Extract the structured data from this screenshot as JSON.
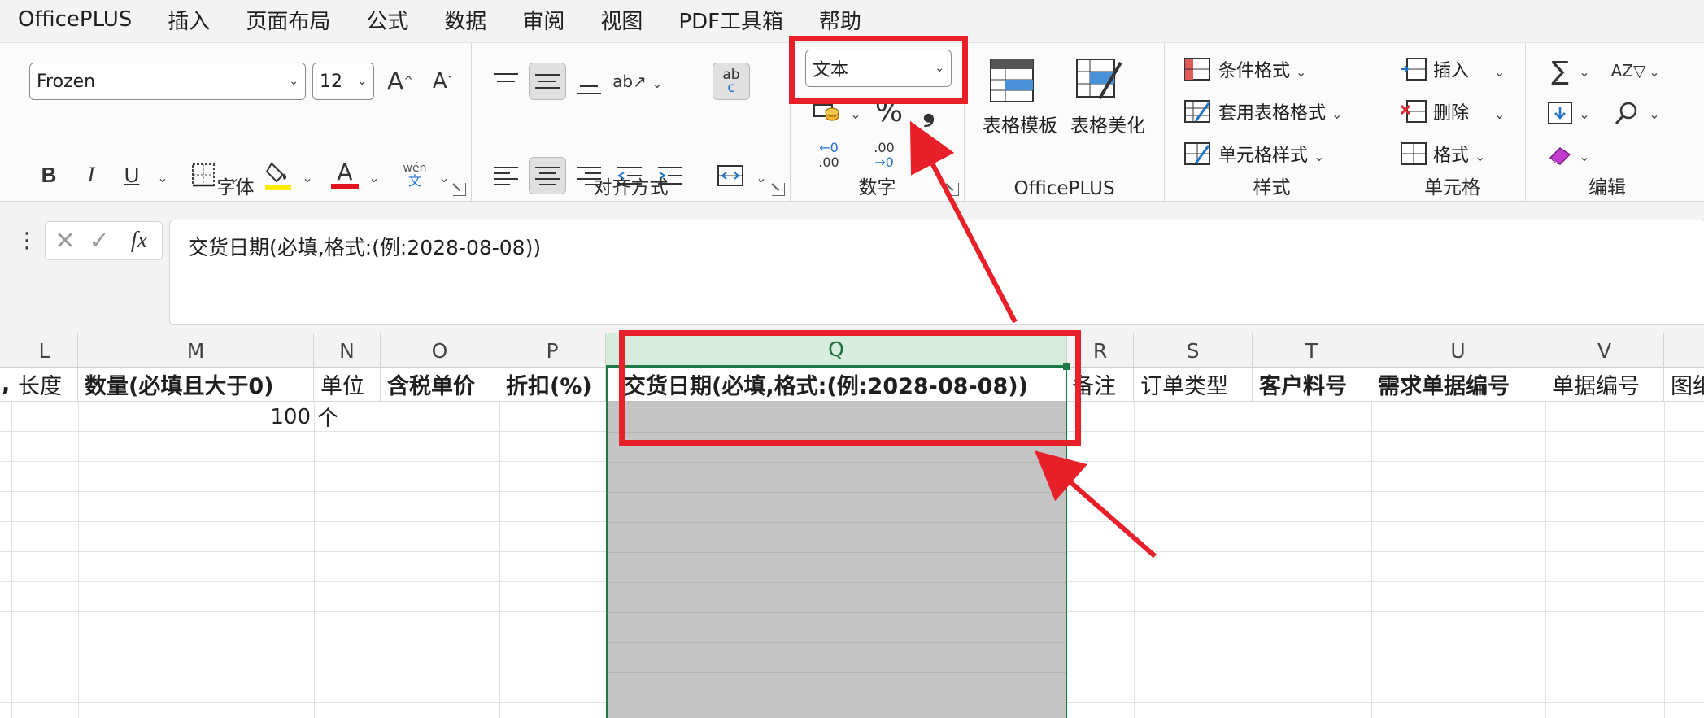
{
  "menu": [
    "OfficePLUS",
    "插入",
    "页面布局",
    "公式",
    "数据",
    "审阅",
    "视图",
    "PDF工具箱",
    "帮助"
  ],
  "font": {
    "name": "Frozen",
    "size": "12",
    "increase_label": "A",
    "decrease_label": "A",
    "bold": "B",
    "italic": "I",
    "underline": "U",
    "font_color_letter": "A",
    "pinyin_top": "wén",
    "pinyin_bottom": "文",
    "group_label": "字体"
  },
  "alignment": {
    "wrap_label": "ab",
    "wrap_label2": "c",
    "group_label": "对齐方式"
  },
  "number": {
    "format_value": "文本",
    "percent": "%",
    "comma": "❟",
    "dec_inc_top": "←0",
    "dec_inc_bottom": ".00",
    "dec_dec_top": ".00",
    "dec_dec_bottom": "→0",
    "group_label": "数字"
  },
  "officeplus": {
    "template": "表格模板",
    "beautify": "表格美化",
    "group_label": "OfficePLUS"
  },
  "styles": {
    "conditional": "条件格式",
    "table_format": "套用表格格式",
    "cell_style": "单元格样式",
    "group_label": "样式"
  },
  "cells": {
    "insert": "插入",
    "delete": "删除",
    "format": "格式",
    "group_label": "单元格"
  },
  "editing": {
    "group_label": "编辑"
  },
  "formula": {
    "fx": "fx",
    "content": "交货日期(必填,格式:(例:2028-08-08))"
  },
  "columns": [
    "L",
    "M",
    "N",
    "O",
    "P",
    "Q",
    "R",
    "S",
    "T",
    "U",
    "V"
  ],
  "headers": {
    "l": "长度",
    "m": "数量(必填且大于0)",
    "n": "单位",
    "o": "含税单价",
    "p": "折扣(%)",
    "q": "交货日期(必填,格式:(例:2028-08-08))",
    "r": "备注",
    "s": "订单类型",
    "t": "客户料号",
    "u": "需求单据编号",
    "v": "单据编号",
    "w": "图纸"
  },
  "row1": {
    "quantity": "100",
    "unit": "个"
  }
}
